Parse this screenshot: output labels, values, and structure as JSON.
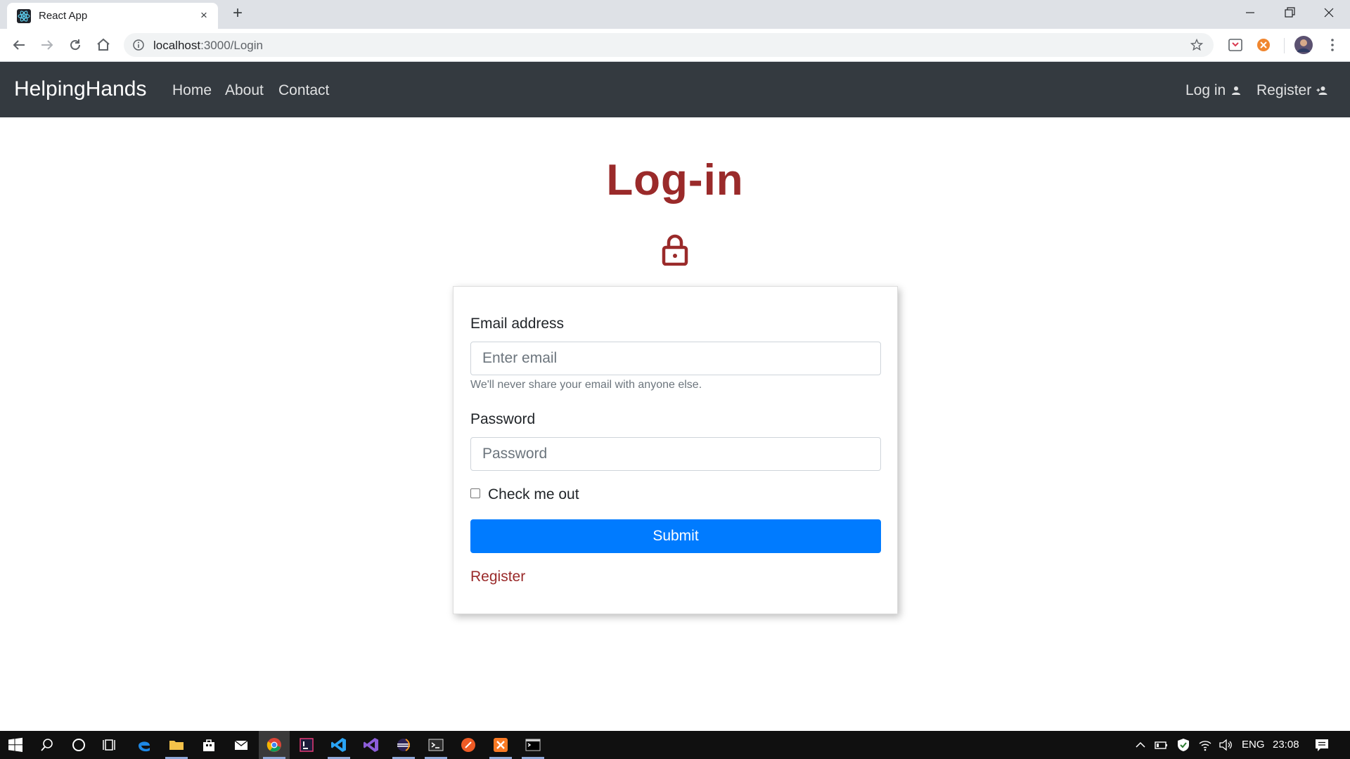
{
  "browser": {
    "tab_title": "React App",
    "tab_close": "×",
    "new_tab": "+",
    "url_host": "localhost",
    "url_path": ":3000/Login"
  },
  "navbar": {
    "brand": "HelpingHands",
    "links": [
      "Home",
      "About",
      "Contact"
    ],
    "login_label": "Log in",
    "register_label": "Register"
  },
  "page": {
    "title": "Log-in",
    "lock_color": "#9a2a2a"
  },
  "form": {
    "email_label": "Email address",
    "email_placeholder": "Enter email",
    "email_help": "We'll never share your email with anyone else.",
    "password_label": "Password",
    "password_placeholder": "Password",
    "remember_label": "Check me out",
    "remember_checked": false,
    "submit_label": "Submit",
    "register_link": "Register"
  },
  "taskbar": {
    "language": "ENG",
    "time": "23:08"
  },
  "colors": {
    "navbar_bg": "#343a40",
    "accent_red": "#9a2a2a",
    "primary_blue": "#007bff"
  }
}
